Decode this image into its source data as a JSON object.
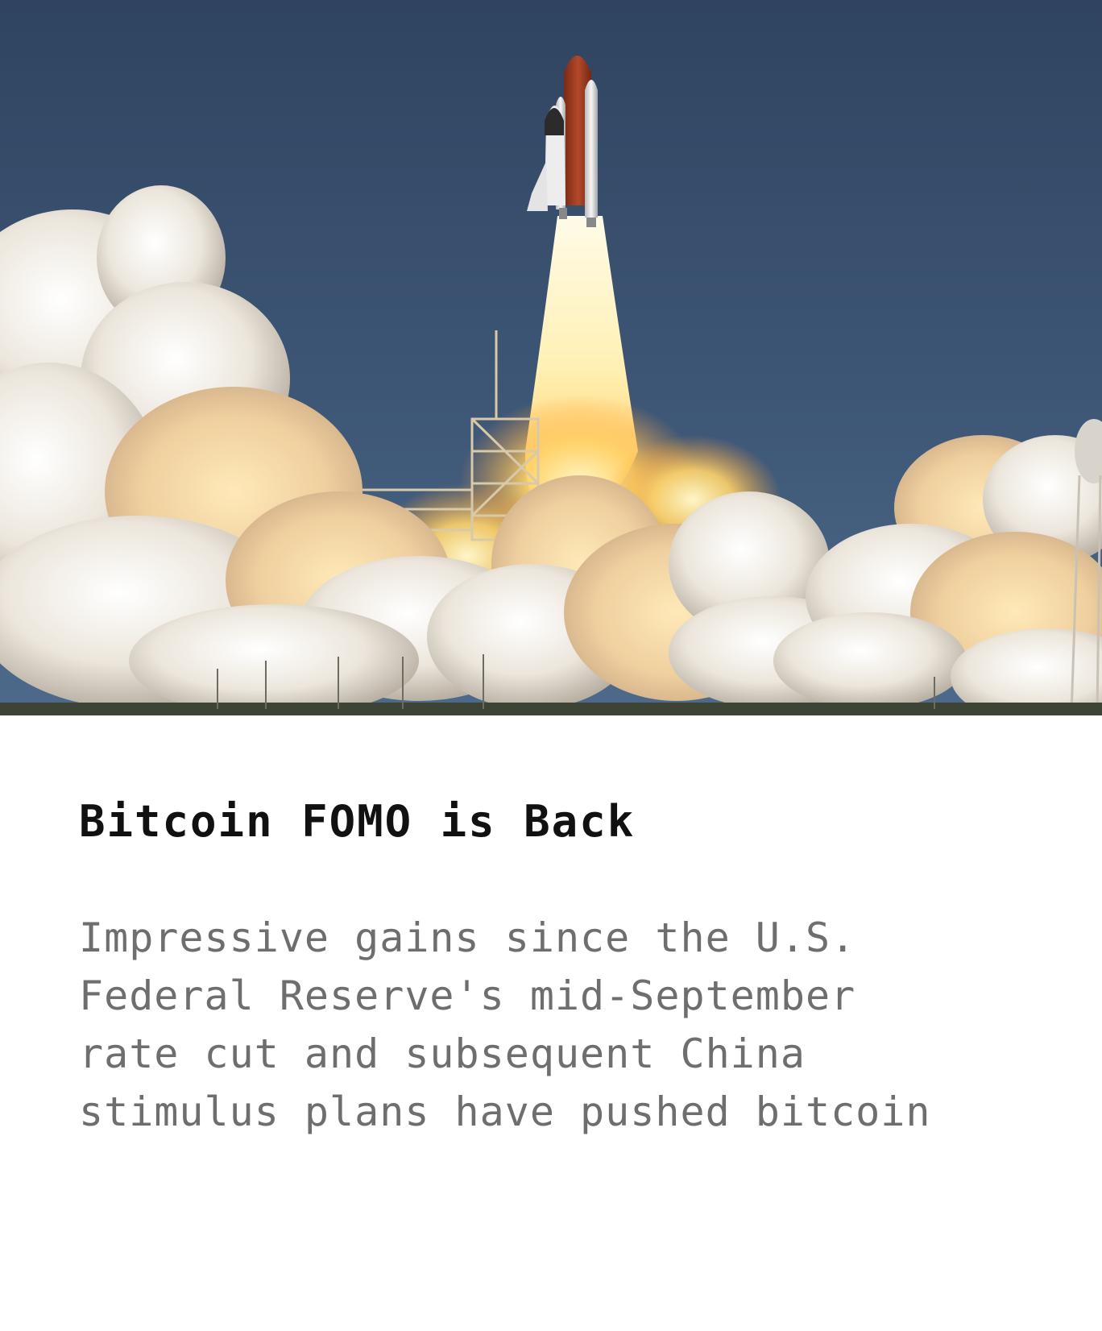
{
  "article": {
    "image": {
      "icon": "rocket-launch-photo",
      "colors": {
        "sky_top": "#2f4460",
        "sky_bottom": "#4b6788",
        "flame": "#ffd774",
        "smoke": "#efe3d2",
        "tank": "#a9401f"
      }
    },
    "title": "Bitcoin FOMO is Back",
    "summary_lines": [
      "Impressive gains since the U.S.",
      "Federal Reserve's mid-September",
      "rate cut and subsequent China",
      "stimulus plans have pushed bitcoin"
    ],
    "colors": {
      "title": "#111111",
      "summary": "#6e6e6e",
      "background": "#ffffff"
    }
  }
}
